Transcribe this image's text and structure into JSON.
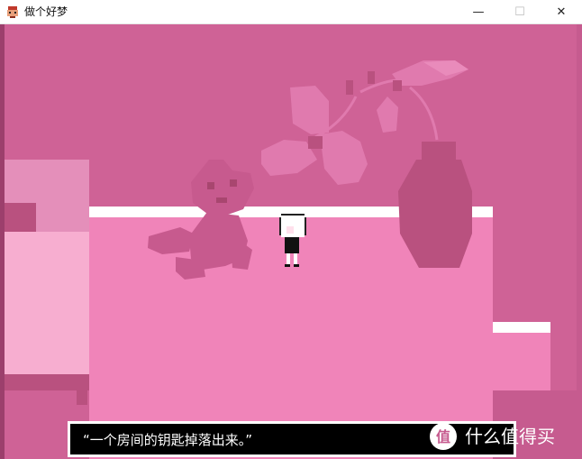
{
  "window": {
    "title": "做个好梦",
    "app_icon": "game-app-icon",
    "controls": {
      "minimize": "—",
      "maximize": "☐",
      "close": "✕"
    }
  },
  "scene": {
    "description_objects": [
      "bed",
      "teddy-bear-shadow",
      "flowers-shadow",
      "vase",
      "player-character"
    ]
  },
  "dialog": {
    "text": "“一个房间的钥匙掉落出来。”"
  },
  "watermark": {
    "text": "什么值得买",
    "logo_char": "值"
  },
  "colors": {
    "wall": "#cf6296",
    "floor": "#f084b9",
    "trim": "#ffffff",
    "shadow": "#b9517f",
    "dialog_bg": "#000000"
  }
}
